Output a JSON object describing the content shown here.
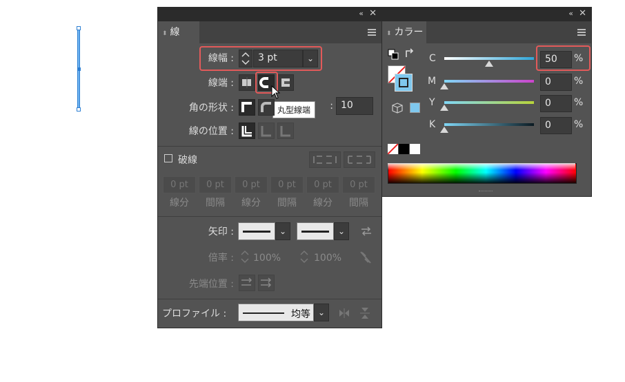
{
  "stroke_panel": {
    "tab_label": "線",
    "weight": {
      "label": "線幅",
      "value": "3 pt"
    },
    "cap": {
      "label": "線端",
      "tooltip": "丸型線端"
    },
    "corner": {
      "label": "角の形状",
      "limit_value": "10"
    },
    "align": {
      "label": "線の位置"
    },
    "dashed": {
      "label": "破線",
      "checked": false,
      "cells": [
        "0 pt",
        "0 pt",
        "0 pt",
        "0 pt",
        "0 pt",
        "0 pt"
      ],
      "labels": [
        "線分",
        "間隔",
        "線分",
        "間隔",
        "線分",
        "間隔"
      ]
    },
    "arrows": {
      "label": "矢印"
    },
    "scale": {
      "label": "倍率",
      "start": "100%",
      "end": "100%"
    },
    "tip": {
      "label": "先端位置"
    },
    "profile": {
      "label": "プロファイル",
      "value": "均等"
    },
    "colon": ":"
  },
  "color_panel": {
    "tab_label": "カラー",
    "channels": [
      {
        "name": "C",
        "value": "50",
        "unit": "%",
        "level": 0.5,
        "track_color": "#2fa6d9"
      },
      {
        "name": "M",
        "value": "0",
        "unit": "%",
        "level": 0,
        "track_color": "#cc44cc"
      },
      {
        "name": "Y",
        "value": "0",
        "unit": "%",
        "level": 0,
        "track_color": "#b8d43a"
      },
      {
        "name": "K",
        "value": "0",
        "unit": "%",
        "level": 0,
        "track_color": "#2b4a5e"
      }
    ],
    "stroke_color": "#7fc8ee"
  },
  "colors": {
    "highlight": "#e35a5a",
    "selection": "#2d7fd3"
  }
}
